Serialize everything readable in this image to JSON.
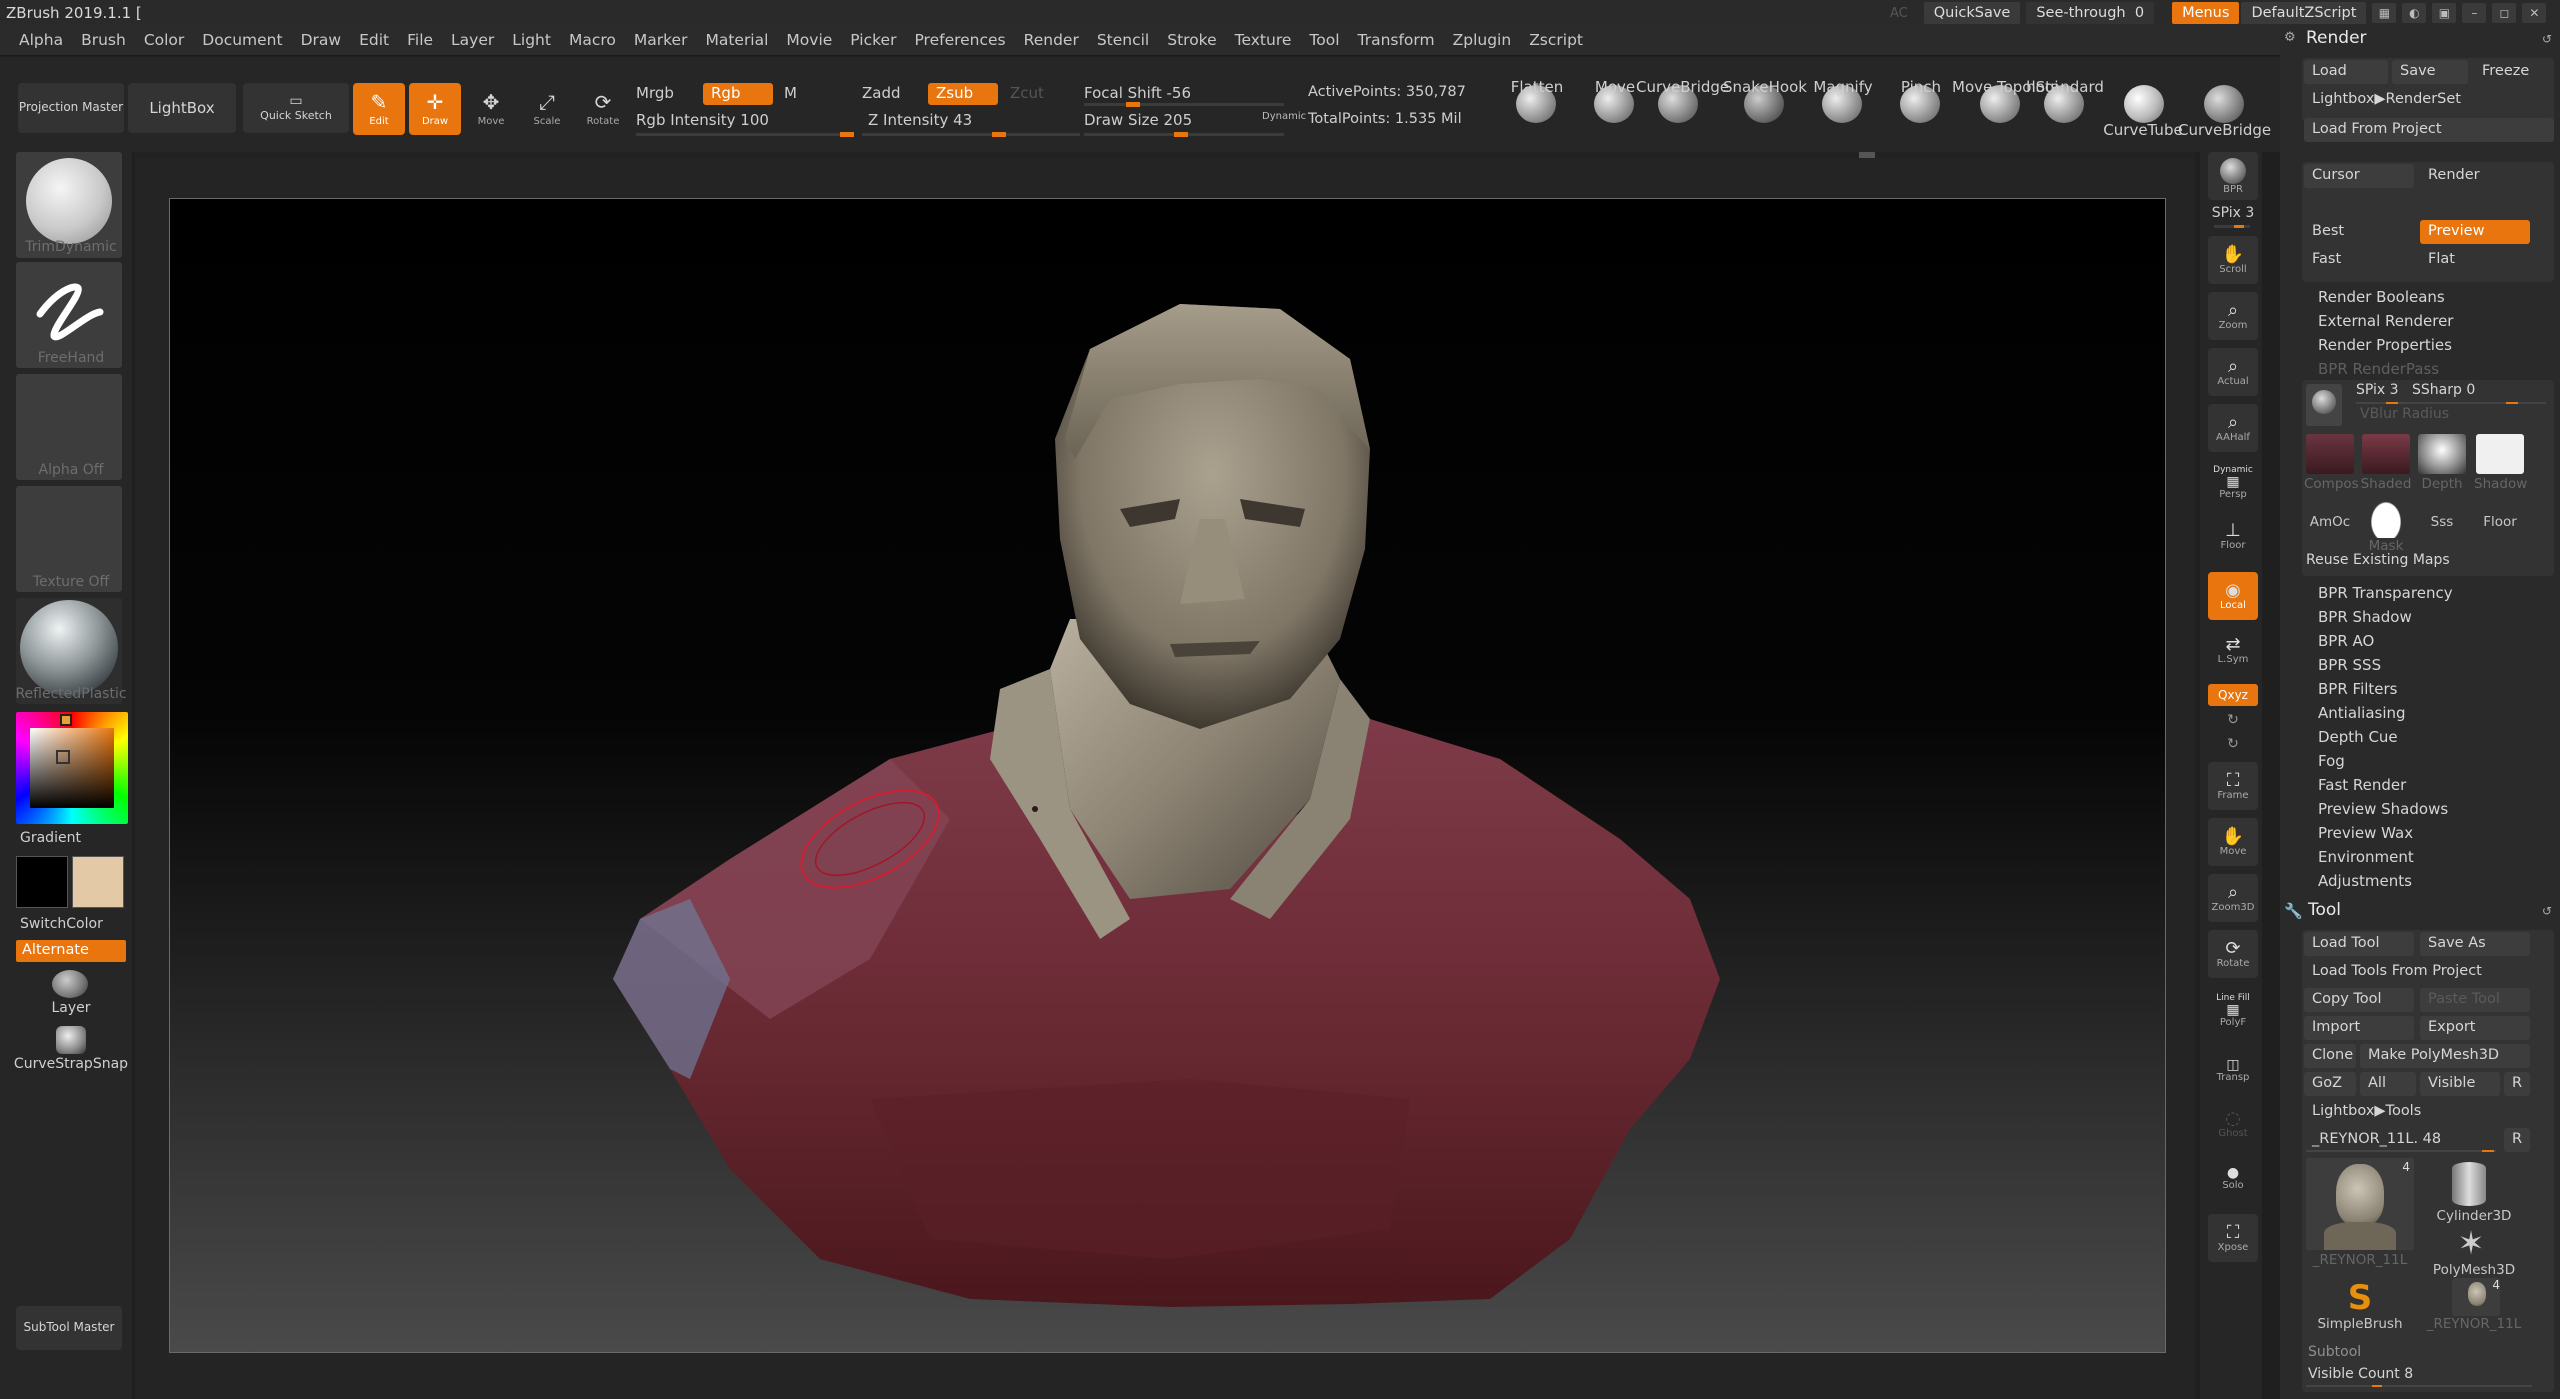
{
  "app": {
    "title": "ZBrush 2019.1.1 ["
  },
  "menubar": {
    "items": [
      "Alpha",
      "Brush",
      "Color",
      "Document",
      "Draw",
      "Edit",
      "File",
      "Layer",
      "Light",
      "Macro",
      "Marker",
      "Material",
      "Movie",
      "Picker",
      "Preferences",
      "Render",
      "Stencil",
      "Stroke",
      "Texture",
      "Tool",
      "Transform",
      "Zplugin",
      "Zscript"
    ]
  },
  "topright": {
    "ac": "AC",
    "quicksave": "QuickSave",
    "seethrough_label": "See-through",
    "seethrough_value": "0",
    "menus": "Menus",
    "script": "DefaultZScript"
  },
  "toolbar": {
    "projection_master": "Projection Master",
    "lightbox": "LightBox",
    "quick_sketch": "Quick Sketch",
    "edit": "Edit",
    "draw": "Draw",
    "move": "Move",
    "scale": "Scale",
    "rotate": "Rotate",
    "mrgb": "Mrgb",
    "rgb": "Rgb",
    "m": "M",
    "rgb_intensity": "Rgb Intensity 100",
    "zadd": "Zadd",
    "zsub": "Zsub",
    "zcut": "Zcut",
    "z_intensity": "Z Intensity 43",
    "focal_shift": "Focal Shift -56",
    "draw_size": "Draw Size 205",
    "dynamic": "Dynamic",
    "active_points": "ActivePoints: 350,787",
    "total_points": "TotalPoints: 1.535 Mil",
    "brushes": [
      "Flatten",
      "Move",
      "CurveBridge",
      "SnakeHook",
      "Magnify",
      "Pinch",
      "Move Topologi",
      "hStandard",
      "CurveTube",
      "CurveBridge"
    ]
  },
  "leftshelf": {
    "brush": "TrimDynamic",
    "stroke": "FreeHand",
    "alpha": "Alpha Off",
    "texture": "Texture Off",
    "material": "ReflectedPlastic",
    "gradient": "Gradient",
    "switchcolor": "SwitchColor",
    "alternate": "Alternate",
    "layer": "Layer",
    "curvestrap": "CurveStrapSnap",
    "subtool_master": "SubTool Master",
    "primary_color": "#000000",
    "secondary_color": "#e4c9a6"
  },
  "rightbar": {
    "bpr": "BPR",
    "spix": "SPix 3",
    "scroll": "Scroll",
    "zoom": "Zoom",
    "actual": "Actual",
    "aahalf": "AAHalf",
    "dynamic": "Dynamic",
    "persp": "Persp",
    "floor": "Floor",
    "local": "Local",
    "lsym": "L.Sym",
    "xyz": "Qxyz",
    "frame": "Frame",
    "move": "Move",
    "zoom3d": "Zoom3D",
    "rotate": "Rotate",
    "linefill": "Line Fill",
    "polyf": "PolyF",
    "transp": "Transp",
    "ghost": "Ghost",
    "solo": "Solo",
    "xpose": "Xpose"
  },
  "render_panel": {
    "title": "Render",
    "load": "Load",
    "save": "Save",
    "freeze": "Freeze",
    "lightbox_renderset": "Lightbox▶RenderSet",
    "load_from_project": "Load From Project",
    "cursor": "Cursor",
    "render": "Render",
    "best": "Best",
    "preview": "Preview",
    "fast": "Fast",
    "flat": "Flat",
    "items": [
      "Render Booleans",
      "External Renderer",
      "Render Properties"
    ],
    "bpr_renderpass": "BPR RenderPass",
    "bpr_spix": "SPix 3",
    "bpr_ssharp": "SSharp 0",
    "vblur": "VBlur Radius",
    "passes": [
      "Compos",
      "Shaded",
      "Depth",
      "Shadow"
    ],
    "amoc": "AmOc",
    "mask": "Mask",
    "sss": "Sss",
    "floor": "Floor",
    "reuse": "Reuse Existing Maps",
    "items2": [
      "BPR Transparency",
      "BPR Shadow",
      "BPR AO",
      "BPR SSS",
      "BPR Filters",
      "Antialiasing",
      "Depth Cue",
      "Fog",
      "Fast Render",
      "Preview Shadows",
      "Preview Wax",
      "Environment",
      "Adjustments"
    ]
  },
  "tool_panel": {
    "title": "Tool",
    "load_tool": "Load Tool",
    "save_as": "Save As",
    "load_tools_from_project": "Load Tools From Project",
    "copy_tool": "Copy Tool",
    "paste_tool": "Paste Tool",
    "import": "Import",
    "export": "Export",
    "clone": "Clone",
    "make_polymesh": "Make PolyMesh3D",
    "goz": "GoZ",
    "all": "All",
    "visible": "Visible",
    "r": "R",
    "lightbox_tools": "Lightbox▶Tools",
    "current_tool": "_REYNOR_11L. 48",
    "thumbs": [
      "_REYNOR_11L",
      "Cylinder3D",
      "PolyMesh3D",
      "SimpleBrush",
      "_REYNOR_11L"
    ],
    "badge": "4",
    "subtool": "Subtool",
    "visible_count": "Visible Count 8"
  }
}
